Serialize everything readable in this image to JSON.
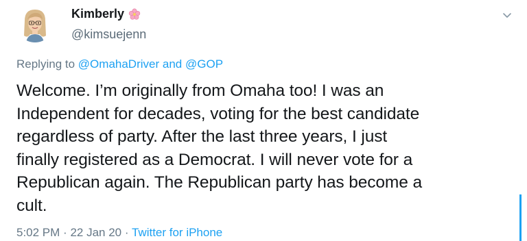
{
  "author": {
    "display_name": "Kimberly",
    "handle": "@kimsuejenn"
  },
  "replying": {
    "prefix": "Replying to",
    "user1": "@OmahaDriver",
    "and": "and",
    "user2": "@GOP"
  },
  "tweet": {
    "lines": [
      "Welcome. I’m originally from Omaha too! I was an",
      "Independent for decades, voting for the best candidate",
      "regardless of party. After the last three years, I just",
      "finally registered as a Democrat. I will never vote for a",
      "Republican again. The Republican party has become a",
      "cult."
    ]
  },
  "meta": {
    "time": "5:02 PM",
    "sep1": "·",
    "date": "22 Jan 20",
    "sep2": "·",
    "source": "Twitter for iPhone"
  },
  "icons": {
    "avatar": "cartoon-woman-avatar",
    "badge": "cherry-blossom-icon",
    "menu": "chevron-down-icon"
  },
  "colors": {
    "accent": "#1da1f2",
    "text": "#14171a",
    "muted": "#657786"
  }
}
